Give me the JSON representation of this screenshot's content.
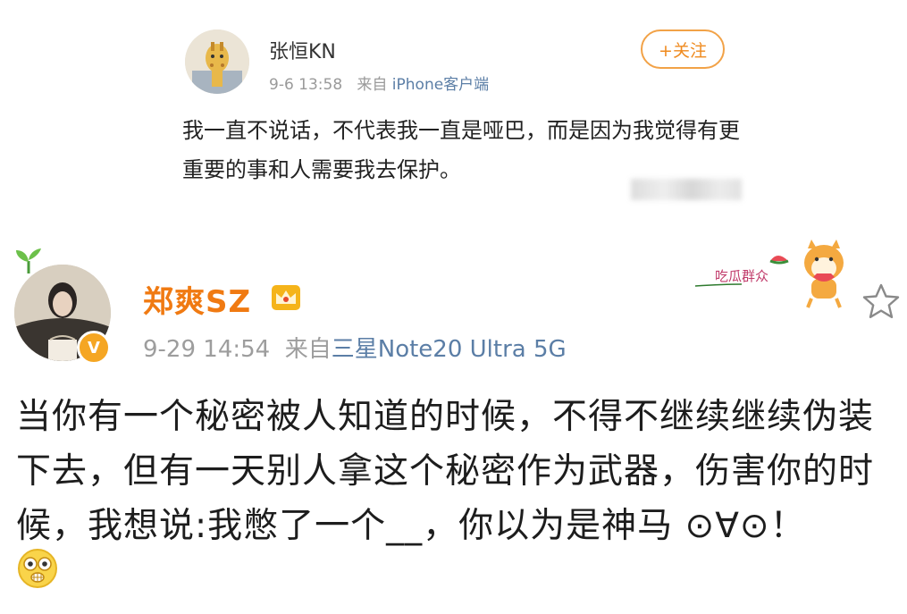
{
  "post1": {
    "username": "张恒KN",
    "time": "9-6 13:58",
    "source_prefix": "来自",
    "source_device": "iPhone客户端",
    "follow_label": "+关注",
    "text": "我一直不说话，不代表我一直是哑巴，而是因为我觉得有更重要的事和人需要我去保护。"
  },
  "post2": {
    "username": "郑爽SZ",
    "time": "9-29 14:54",
    "source_prefix": "来自",
    "source_device": "三星Note20 Ultra 5G",
    "verified_badge": "V",
    "sticker_text": "吃瓜群众",
    "text": "当你有一个秘密被人知道的时候，不得不继续继续伪装下去，但有一天别人拿这个秘密作为武器，伤害你的时候，我想说:我憋了一个__，你以为是神马 ⊙∀⊙！"
  },
  "icons": {
    "follow": "plus-icon",
    "favorite": "star-outline-icon",
    "emoji": "shocked-face-icon",
    "decoration": "sprout-icon",
    "vip": "crown-icon"
  },
  "colors": {
    "accent_orange": "#f07a12",
    "follow_border": "#f2a247",
    "link_blue": "#5b7ea6",
    "meta_gray": "#9d9d9d"
  }
}
